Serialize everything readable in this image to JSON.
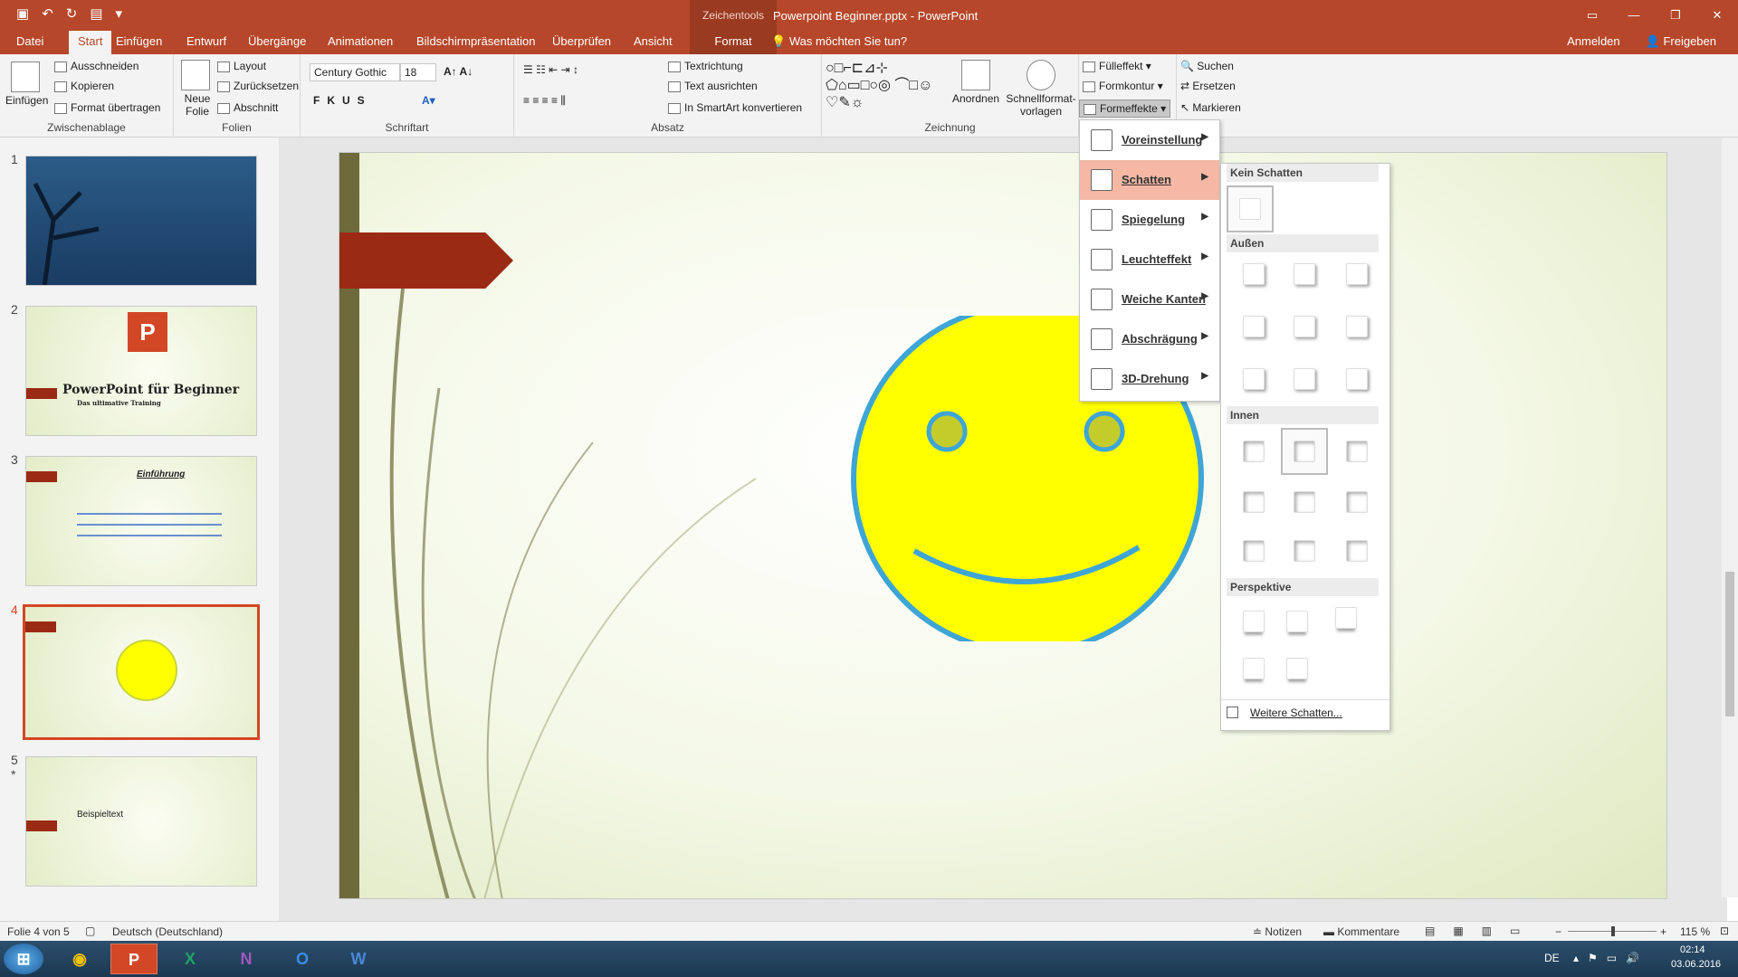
{
  "titlebar": {
    "context_label": "Zeichentools",
    "doc_title": "Powerpoint Beginner.pptx - PowerPoint"
  },
  "tabs": [
    "Datei",
    "Start",
    "Einfügen",
    "Entwurf",
    "Übergänge",
    "Animationen",
    "Bildschirmpräsentation",
    "Überprüfen",
    "Ansicht",
    "Format"
  ],
  "tell_me": "Was möchten Sie tun?",
  "account": {
    "signin": "Anmelden",
    "share": "Freigeben"
  },
  "ribbon": {
    "clipboard": {
      "label": "Zwischenablage",
      "paste": "Einfügen",
      "cut": "Ausschneiden",
      "copy": "Kopieren",
      "format_painter": "Format übertragen"
    },
    "slides": {
      "label": "Folien",
      "new_slide": "Neue Folie",
      "layout": "Layout",
      "reset": "Zurücksetzen",
      "section": "Abschnitt"
    },
    "font": {
      "label": "Schriftart",
      "name": "Century Gothic",
      "size": "18"
    },
    "paragraph": {
      "label": "Absatz",
      "text_direction": "Textrichtung",
      "align_text": "Text ausrichten",
      "smartart": "In SmartArt konvertieren"
    },
    "drawing": {
      "label": "Zeichnung",
      "arrange": "Anordnen",
      "quick_styles": "Schnellformat-vorlagen",
      "fill": "Fülleffekt",
      "outline": "Formkontur",
      "effects": "Formeffekte"
    },
    "editing": {
      "label": "eiten",
      "find": "Suchen",
      "replace": "Ersetzen",
      "select": "Markieren"
    }
  },
  "slides_panel": {
    "slide2_title": "PowerPoint für Beginner",
    "slide2_subtitle": "Das ultimative Training",
    "slide3_title": "Einführung",
    "slide5_title": "Beispieltext",
    "slide5_star": "*"
  },
  "effects_menu": {
    "items": [
      "Voreinstellung",
      "Schatten",
      "Spiegelung",
      "Leuchteffekt",
      "Weiche Kanten",
      "Abschrägung",
      "3D-Drehung"
    ],
    "highlighted": "Schatten"
  },
  "shadow_menu": {
    "sections": [
      "Kein Schatten",
      "Außen",
      "Innen",
      "Perspektive"
    ],
    "more": "Weitere Schatten..."
  },
  "status": {
    "slide_of": "Folie 4 von 5",
    "language": "Deutsch (Deutschland)",
    "notes": "Notizen",
    "comments": "Kommentare",
    "zoom": "115 %"
  },
  "taskbar": {
    "lang": "DE",
    "time": "02:14",
    "date": "03.06.2016"
  },
  "colors": {
    "accent": "#b7472a",
    "smiley": "#ffff00",
    "smiley_outline": "#3ea5d6"
  }
}
